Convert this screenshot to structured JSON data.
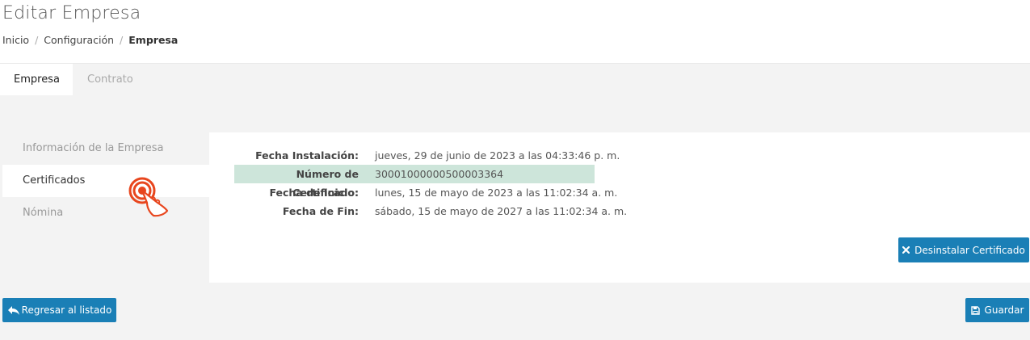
{
  "header": {
    "title": "Editar Empresa",
    "breadcrumb": [
      "Inicio",
      "Configuración",
      "Empresa"
    ]
  },
  "tabs": [
    {
      "label": "Empresa",
      "active": true
    },
    {
      "label": "Contrato",
      "active": false
    }
  ],
  "side_menu": [
    {
      "label": "Información de la Empresa",
      "active": false
    },
    {
      "label": "Certificados",
      "active": true
    },
    {
      "label": "Nómina",
      "active": false
    }
  ],
  "certificate": {
    "rows": [
      {
        "label": "Fecha Instalación:",
        "value": "jueves, 29 de junio de 2023 a las 04:33:46 p. m."
      },
      {
        "label": "Número de Certificado:",
        "value": "30001000000500003364"
      },
      {
        "label": "Fecha de Inicio:",
        "value": "lunes, 15 de mayo de 2023 a las 11:02:34 a. m."
      },
      {
        "label": "Fecha de Fin:",
        "value": "sábado, 15 de mayo de 2027 a las 11:02:34 a. m."
      }
    ],
    "uninstall_label": "Desinstalar Certificado"
  },
  "footer": {
    "back_label": "Regresar al listado",
    "save_label": "Guardar"
  },
  "colors": {
    "primary": "#1a7fb6",
    "highlight_row": "#cde5da",
    "pointer": "#e8461e",
    "background": "#f3f3f3"
  },
  "icons": {
    "uninstall": "x-icon",
    "back": "reply-arrow-icon",
    "save": "floppy-disk-icon",
    "pointer": "tap-hand-icon"
  }
}
